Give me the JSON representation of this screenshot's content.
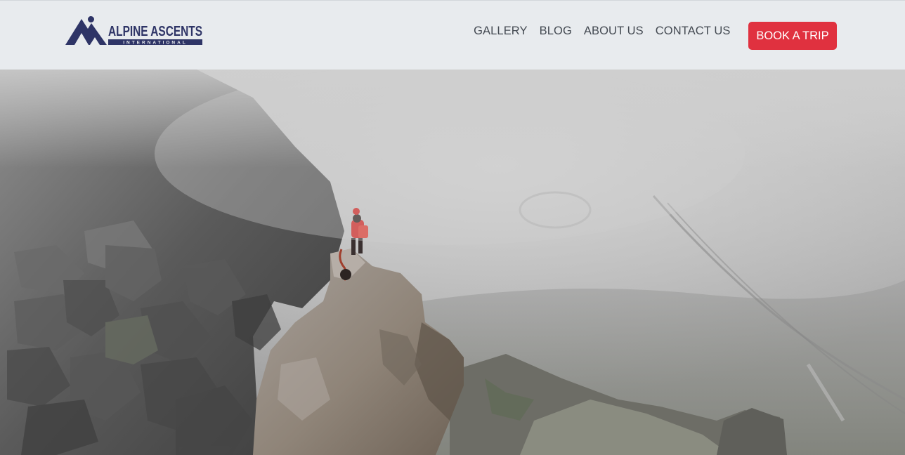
{
  "brand": {
    "name": "ALPINE ASCENTS",
    "tagline": "INTERNATIONAL",
    "color": "#2e3466"
  },
  "nav": {
    "items": [
      {
        "label": "GALLERY"
      },
      {
        "label": "BLOG"
      },
      {
        "label": "ABOUT US"
      },
      {
        "label": "CONTACT US"
      }
    ],
    "cta_label": "BOOK A TRIP",
    "cta_color": "#e0313f"
  },
  "hero": {
    "image": "misty-mountain-summit-climbers-photo"
  }
}
